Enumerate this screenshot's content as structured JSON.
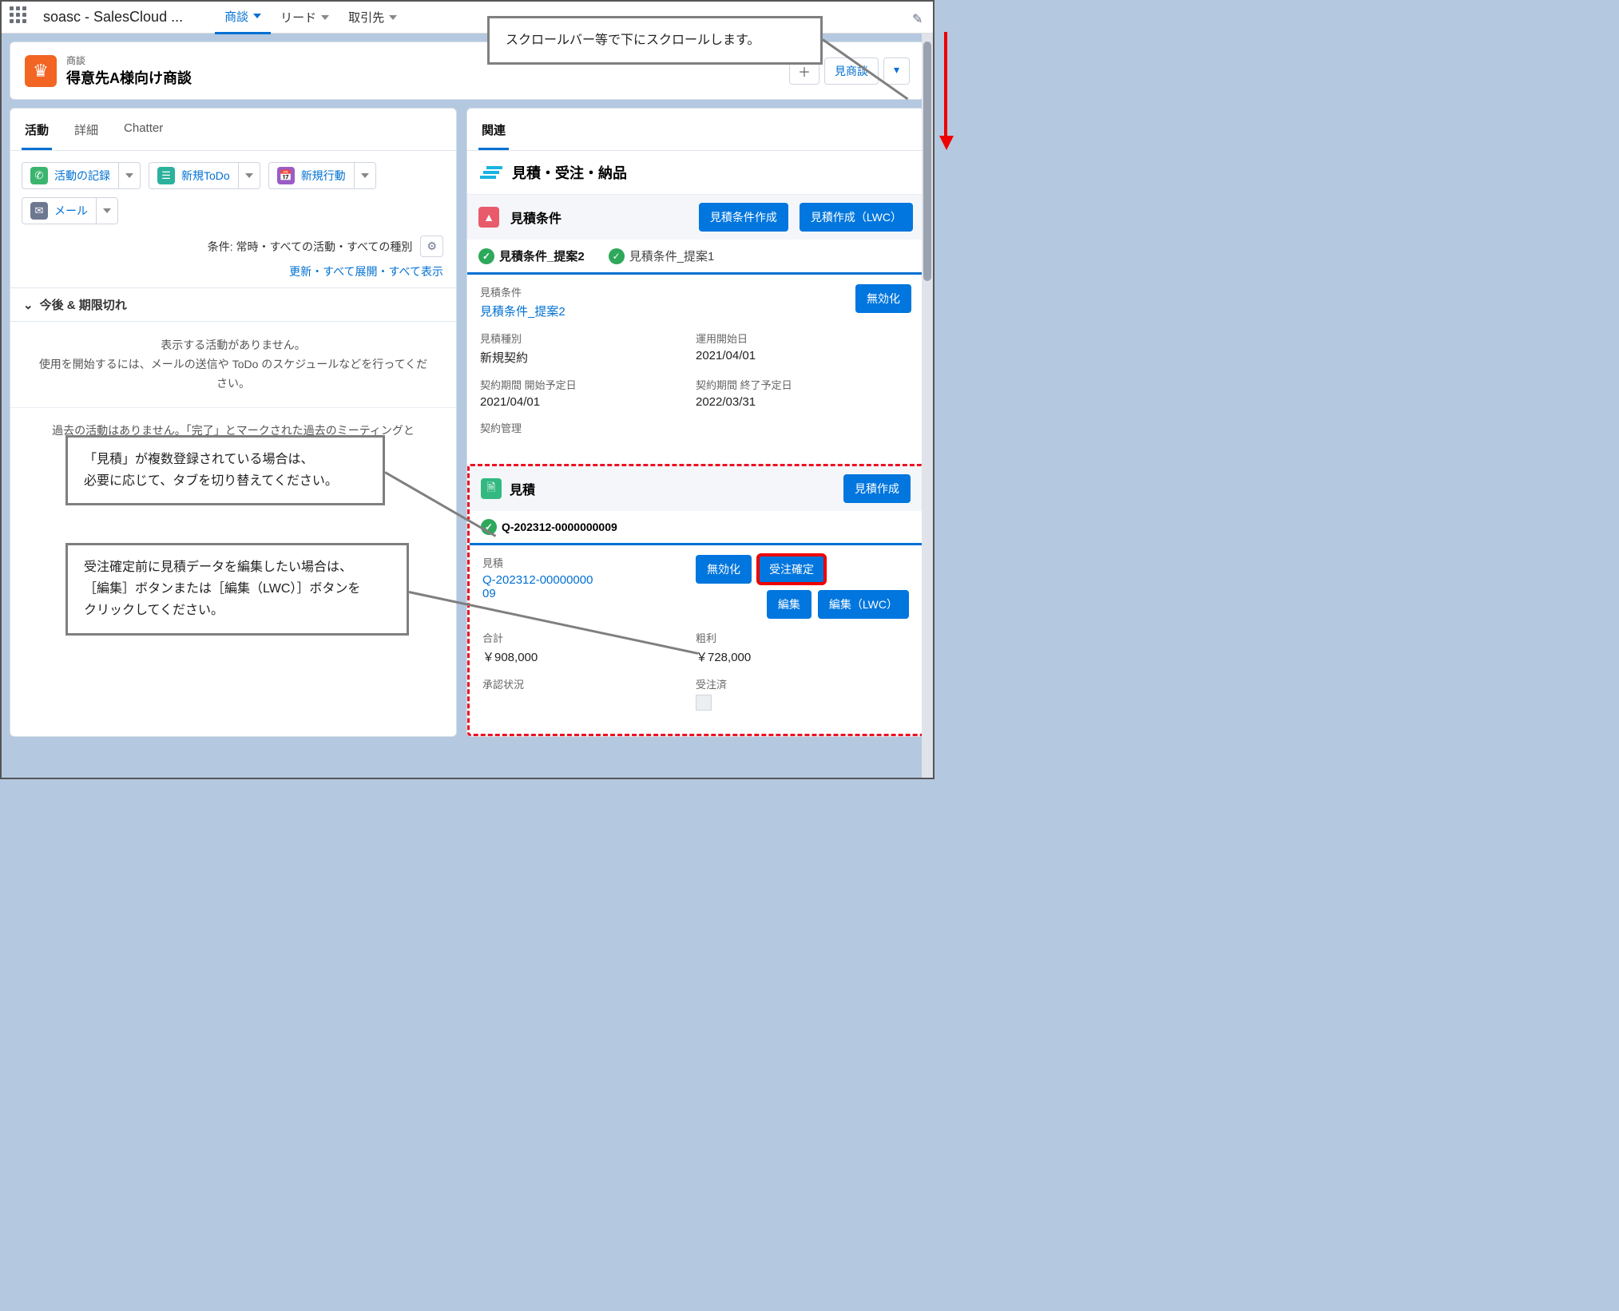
{
  "topbar": {
    "app_name": "soasc - SalesCloud ...",
    "nav": [
      {
        "label": "商談",
        "active": true
      },
      {
        "label": "リード",
        "active": false
      },
      {
        "label": "取引先",
        "active": false
      }
    ]
  },
  "record": {
    "type": "商談",
    "title": "得意先A様向け商談",
    "action_new_opp": "見商談"
  },
  "left": {
    "tabs": {
      "activity": "活動",
      "detail": "詳細",
      "chatter": "Chatter"
    },
    "buttons": {
      "log_call": "活動の記録",
      "new_todo": "新規ToDo",
      "new_event": "新規行動",
      "mail": "メール"
    },
    "filter_label": "条件: 常時・すべての活動・すべての種別",
    "refresh_label": "更新・すべて展開・すべて表示",
    "upcoming_label": "今後 & 期限切れ",
    "no_activity_1": "表示する活動がありません。",
    "no_activity_2": "使用を開始するには、メールの送信や ToDo のスケジュールなどを行ってください。",
    "past_label": "過去の活動はありません。「完了」とマークされた過去のミーティングと"
  },
  "right": {
    "related_tab": "関連",
    "section_title": "見積・受注・納品",
    "cond_title": "見積条件",
    "btn_cond_create": "見積条件作成",
    "btn_quote_create_lwc": "見積作成（LWC）",
    "prop_tab1": "見積条件_提案2",
    "prop_tab2": "見積条件_提案1",
    "fields": {
      "cond_label": "見積条件",
      "cond_link": "見積条件_提案2",
      "disable_btn": "無効化",
      "type_label": "見積種別",
      "type_val": "新規契約",
      "start_label": "運用開始日",
      "start_val": "2021/04/01",
      "cstart_label": "契約期間 開始予定日",
      "cstart_val": "2021/04/01",
      "cend_label": "契約期間 終了予定日",
      "cend_val": "2022/03/31",
      "contract_mgmt": "契約管理"
    },
    "quote": {
      "title": "見積",
      "create_btn": "見積作成",
      "tab": "Q-202312-0000000009",
      "label": "見積",
      "link": "Q-202312-0000000009",
      "disable": "無効化",
      "confirm": "受注確定",
      "edit": "編集",
      "edit_lwc": "編集（LWC）",
      "total_label": "合計",
      "total_val": "￥908,000",
      "profit_label": "粗利",
      "profit_val": "￥728,000",
      "approval_label": "承認状況",
      "ordered_label": "受注済"
    }
  },
  "callouts": {
    "c1": "スクロールバー等で下にスクロールします。",
    "c2a": "「見積」が複数登録されている場合は、",
    "c2b": "必要に応じて、タブを切り替えてください。",
    "c3a": "受注確定前に見積データを編集したい場合は、",
    "c3b": "［編集］ボタンまたは［編集（LWC）］ボタンを",
    "c3c": "クリックしてください。"
  }
}
